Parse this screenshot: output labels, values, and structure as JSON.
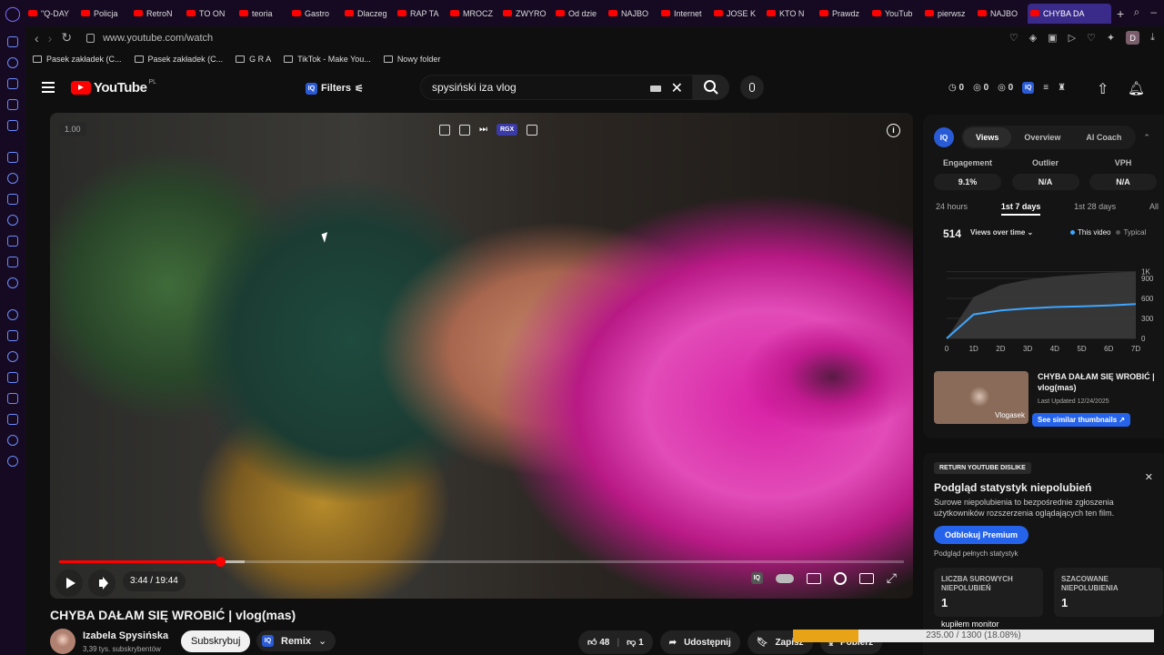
{
  "browser": {
    "tabs": [
      "\"Q-DAY",
      "Policja",
      "RetroN",
      "TO ON",
      "teoria",
      "Gastro",
      "Dlaczeg",
      "RAP TA",
      "MROCZ",
      "ZWYRO",
      "Od dzie",
      "NAJBO",
      "Internet",
      "JOSE K",
      "KTO N",
      "Prawdz",
      "YouTub",
      "pierwsz",
      "NAJBO"
    ],
    "active_tab": "CHYBA DA",
    "url": "www.youtube.com/watch",
    "bookmarks": [
      "Pasek zakładek (C...",
      "Pasek zakładek (C...",
      "G R A",
      "TikTok - Make You...",
      "Nowy folder"
    ],
    "profile_initial": "D"
  },
  "youtube": {
    "logo": "YouTube",
    "region": "PL",
    "filters_label": "Filters",
    "search_query": "spysiński iza vlog",
    "counters": [
      "0",
      "0",
      "0"
    ]
  },
  "video": {
    "speed": "1.00",
    "time": "3:44 / 19:44",
    "progress_fraction": 0.19,
    "buffered_fraction": 0.22,
    "rgx_label": "RGX"
  },
  "below": {
    "title": "CHYBA DAŁAM SIĘ WROBIĆ | vlog(mas)",
    "channel": "Izabela Spysińska",
    "subscribers": "3,39 tys. subskrybentów",
    "subscribe": "Subskrybuj",
    "remix": "Remix",
    "likes": "48",
    "dislikes": "1",
    "share": "Udostępnij",
    "save": "Zapisz",
    "download": "Pobierz"
  },
  "panel": {
    "tabs": [
      "Views",
      "Overview",
      "AI Coach"
    ],
    "stats": [
      {
        "label": "Engagement",
        "value": "9.1%"
      },
      {
        "label": "Outlier",
        "value": "N/A"
      },
      {
        "label": "VPH",
        "value": "N/A"
      }
    ],
    "ranges": [
      "24 hours",
      "1st 7 days",
      "1st 28 days",
      "All"
    ],
    "views": "514",
    "views_selector": "Views over time",
    "legend_this": "This video",
    "legend_typical": "Typical",
    "card_title": "CHYBA DAŁAM SIĘ WROBIĆ | vlog(mas)",
    "card_updated": "Last Updated 12/24/2025",
    "card_thumb_label": "Vlogasek",
    "card_button": "See similar thumbnails ↗"
  },
  "chart_data": {
    "type": "area",
    "x": [
      0,
      10,
      20,
      30,
      40,
      50,
      60,
      70
    ],
    "xtick_labels": [
      "0",
      "1D",
      "2D",
      "3D",
      "4D",
      "5D",
      "6D",
      "7D"
    ],
    "ytick_labels": [
      "0",
      "300",
      "600",
      "900",
      "1K"
    ],
    "ylim": [
      0,
      1200
    ],
    "series": [
      {
        "name": "This video",
        "values": [
          0,
          360,
          420,
          450,
          470,
          480,
          495,
          514
        ],
        "color": "#3ea6ff"
      },
      {
        "name": "Typical",
        "values": [
          0,
          620,
          800,
          880,
          930,
          960,
          985,
          1000
        ],
        "color": "#555555"
      }
    ]
  },
  "dislike": {
    "badge": "RETURN YOUTUBE DISLIKE",
    "title": "Podgląd statystyk niepolubień",
    "desc": "Surowe niepolubienia to bezpośrednie zgłoszenia użytkowników rozszerzenia oglądających ten film.",
    "button": "Odblokuj Premium",
    "sub": "Podgląd pełnych statystyk",
    "raw_label": "LICZBA SUROWYCH NIEPOLUBIEŃ",
    "raw_value": "1",
    "est_label": "SZACOWANE NIEPOLUBIENIA",
    "est_value": "1"
  },
  "download": {
    "filename": "kupiłem monitor",
    "progress_text": "235.00 / 1300 (18.08%)",
    "fraction": 0.1808
  }
}
